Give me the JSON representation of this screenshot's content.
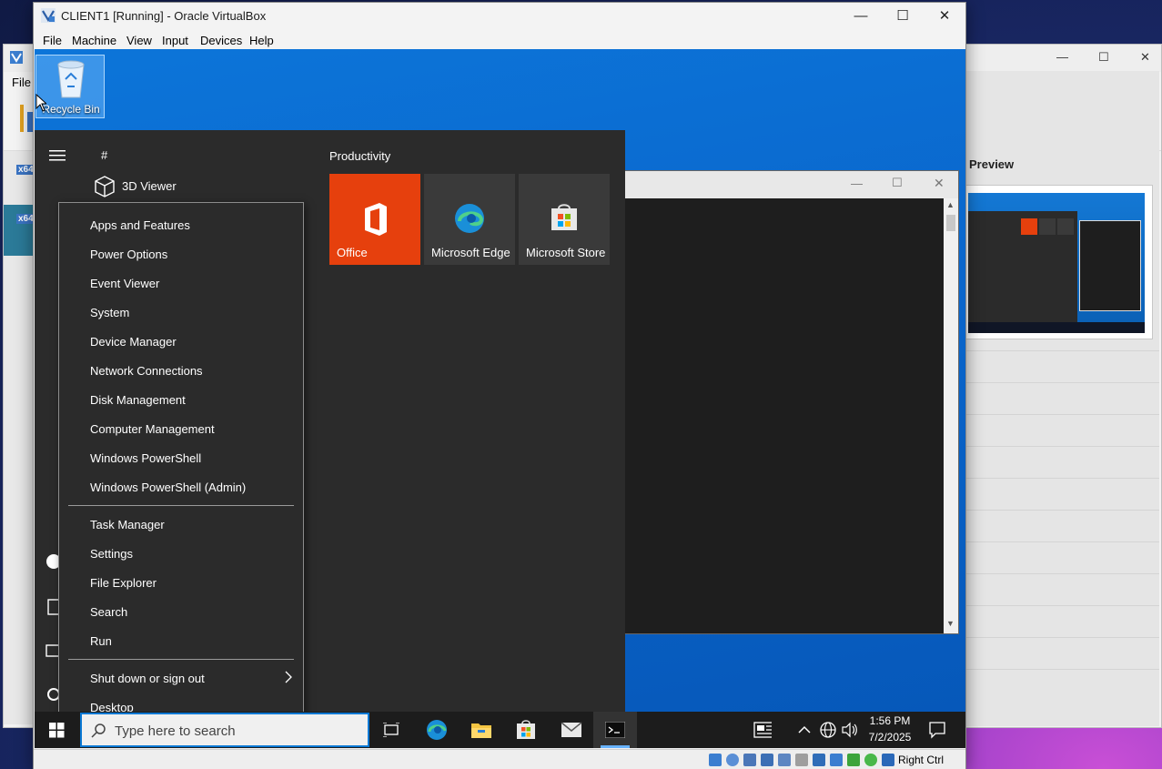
{
  "host": {
    "manager": {
      "menu_file": "File",
      "vm_badge_1": "x64",
      "vm_badge_2": "x64",
      "preview_label": "Preview"
    }
  },
  "vm_window": {
    "title": "CLIENT1 [Running] - Oracle VirtualBox",
    "menu": [
      "File",
      "Machine",
      "View",
      "Input",
      "Devices",
      "Help"
    ],
    "status_host_key": "Right Ctrl"
  },
  "guest": {
    "desktop": {
      "recycle_bin_label": "Recycle Bin"
    },
    "start_menu": {
      "alpha_header": "#",
      "apps": [
        {
          "label": "3D Viewer"
        }
      ],
      "group_header": "Productivity",
      "tiles": [
        {
          "label": "Office",
          "color": "#e6400d"
        },
        {
          "label": "Microsoft Edge"
        },
        {
          "label": "Microsoft Store"
        }
      ]
    },
    "context_menu": {
      "group1": [
        "Apps and Features",
        "Power Options",
        "Event Viewer",
        "System",
        "Device Manager",
        "Network Connections",
        "Disk Management",
        "Computer Management",
        "Windows PowerShell",
        "Windows PowerShell (Admin)"
      ],
      "group2": [
        "Task Manager",
        "Settings",
        "File Explorer",
        "Search",
        "Run"
      ],
      "group3": [
        "Shut down or sign out",
        "Desktop"
      ]
    },
    "taskbar": {
      "search_placeholder": "Type here to search",
      "time": "1:56 PM",
      "date": "7/2/2025"
    }
  },
  "colors": {
    "accent": "#0a78d4",
    "office": "#e6400d",
    "start_bg": "#2b2b2b"
  }
}
